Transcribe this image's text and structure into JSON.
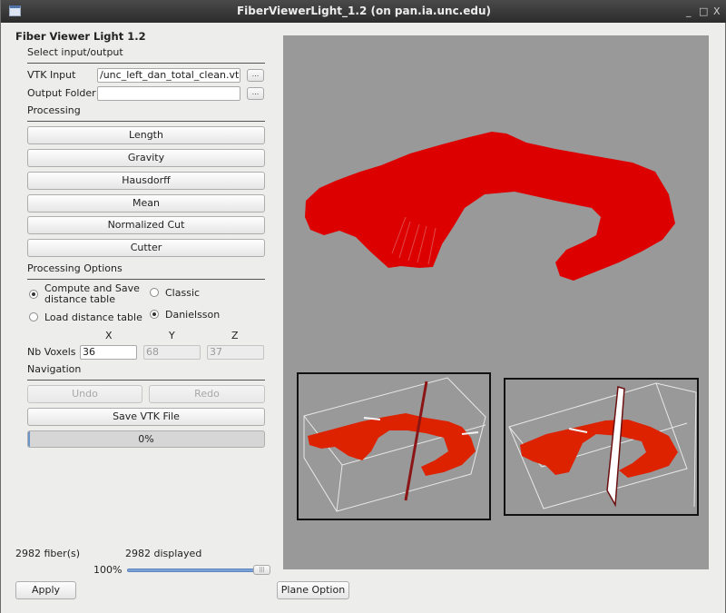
{
  "window": {
    "title": "FiberViewerLight_1.2 (on pan.ia.unc.edu)",
    "controls": {
      "minimize": "_",
      "maximize": "□",
      "close": "X"
    }
  },
  "panel": {
    "app_title": "Fiber Viewer Light 1.2",
    "io": {
      "section_label": "Select input/output",
      "vtk_input_label": "VTK Input",
      "vtk_input_value": "/unc_left_dan_total_clean.vtk",
      "output_folder_label": "Output Folder",
      "output_folder_value": "",
      "browse_label": "..."
    },
    "processing": {
      "section_label": "Processing",
      "buttons": [
        "Length",
        "Gravity",
        "Hausdorff",
        "Mean",
        "Normalized Cut",
        "Cutter"
      ]
    },
    "options": {
      "section_label": "Processing Options",
      "compute_save_label_line1": "Compute and Save",
      "compute_save_label_line2": "distance table",
      "compute_save_selected": true,
      "load_table_label": "Load distance table",
      "load_table_selected": false,
      "classic_label": "Classic",
      "classic_selected": false,
      "danielsson_label": "Danielsson",
      "danielsson_selected": true,
      "axis_labels": [
        "X",
        "Y",
        "Z"
      ],
      "nb_voxels_label": "Nb Voxels",
      "nb_voxels": [
        "36",
        "68",
        "37"
      ]
    },
    "navigation": {
      "section_label": "Navigation",
      "undo_label": "Undo",
      "redo_label": "Redo",
      "save_label": "Save VTK File",
      "progress_percent": 0,
      "progress_text": "0%"
    },
    "footer": {
      "fiber_count": "2982 fiber(s)",
      "displayed_count": "2982 displayed",
      "display_percent_text": "100%",
      "display_percent": 100,
      "apply_label": "Apply",
      "plane_option_label": "Plane Option"
    }
  },
  "viewer": {
    "background_color": "#999999",
    "fiber_color": "#dd0000",
    "inset_fiber_color": "#dd2200",
    "plane_color": "#8b1414"
  }
}
